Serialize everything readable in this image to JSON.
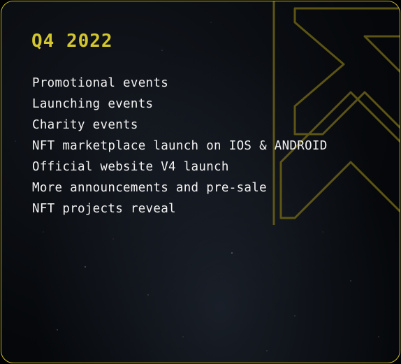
{
  "colors": {
    "accent": "#d4c62e",
    "border": "#c9b82a",
    "text": "#f2f2f2",
    "background": "#05070a"
  },
  "roadmap": {
    "title": "Q4 2022",
    "items": [
      "Promotional events",
      "Launching events",
      "Charity events",
      "NFT marketplace launch on IOS & ANDROID",
      "Official website V4 launch",
      "More announcements and pre-sale",
      "NFT projects reveal"
    ]
  },
  "decor": {
    "watermark_icon": "brand-logo-outline-icon",
    "background_icon": "starfield-background"
  }
}
